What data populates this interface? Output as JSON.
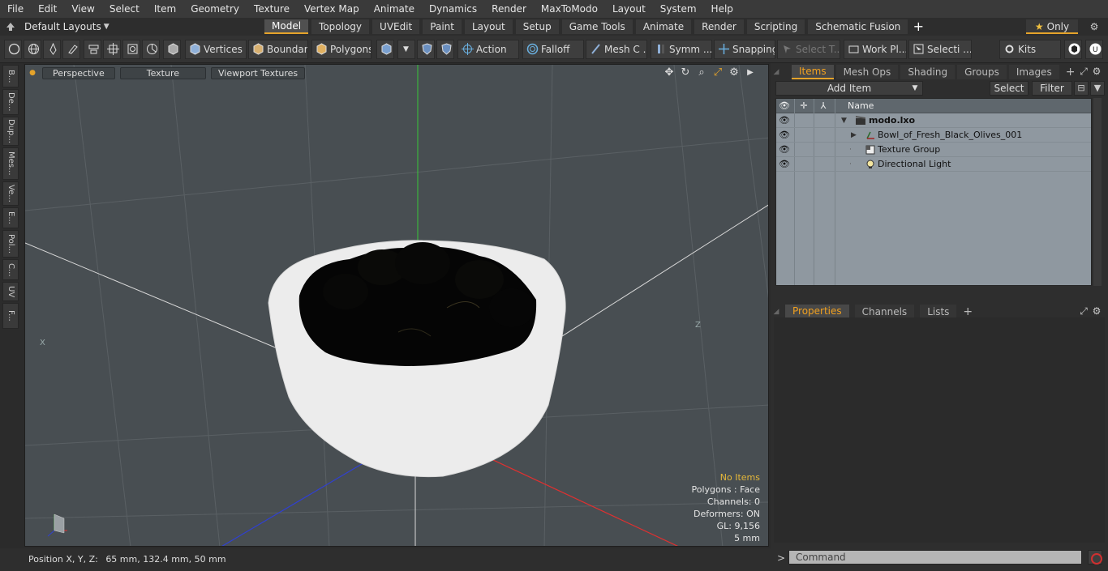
{
  "menubar": [
    "File",
    "Edit",
    "View",
    "Select",
    "Item",
    "Geometry",
    "Texture",
    "Vertex Map",
    "Animate",
    "Dynamics",
    "Render",
    "MaxToModo",
    "Layout",
    "System",
    "Help"
  ],
  "layouts": {
    "label": "Default Layouts",
    "tabs": [
      "Model",
      "Topology",
      "UVEdit",
      "Paint",
      "Layout",
      "Setup",
      "Game Tools",
      "Animate",
      "Render",
      "Scripting",
      "Schematic Fusion"
    ],
    "active_tab": "Model",
    "only_label": "Only"
  },
  "toolbar": {
    "vertices": "Vertices",
    "boundary": "Boundary",
    "polygons": "Polygons",
    "action": "Action",
    "falloff": "Falloff",
    "mesh": "Mesh C ...",
    "symmetry": "Symm ...",
    "snapping": "Snapping",
    "select_t": "Select T...",
    "work_plane": "Work Pl...",
    "selection": "Selecti ...",
    "kits": "Kits"
  },
  "left_tabs": [
    "B...",
    "De...",
    "Dup...",
    "Mes...",
    "Ve...",
    "E...",
    "Pol...",
    "C...",
    "UV",
    "F..."
  ],
  "viewport": {
    "buttons": [
      "Perspective",
      "Texture",
      "Viewport Textures"
    ],
    "info": {
      "no_items": "No Items",
      "polygons": "Polygons : Face",
      "channels": "Channels: 0",
      "deformers": "Deformers: ON",
      "gl": "GL: 9,156",
      "scale": "5 mm"
    },
    "axis_x_label": "X",
    "axis_z_label": "Z"
  },
  "status": {
    "position_label": "Position X, Y, Z:",
    "position_value": "65 mm, 132.4 mm, 50 mm"
  },
  "items_panel": {
    "tabs": [
      "Items",
      "Mesh Ops",
      "Shading",
      "Groups",
      "Images"
    ],
    "active_tab": "Items",
    "add_item": "Add Item",
    "select": "Select",
    "filter": "Filter",
    "column_name": "Name",
    "rows": [
      {
        "label": "modo.lxo",
        "bold": true
      },
      {
        "label": "Bowl_of_Fresh_Black_Olives_001",
        "bold": false
      },
      {
        "label": "Texture Group",
        "bold": false
      },
      {
        "label": "Directional Light",
        "bold": false
      }
    ]
  },
  "properties_panel": {
    "tabs": [
      "Properties",
      "Channels",
      "Lists"
    ],
    "active_tab": "Properties"
  },
  "command": {
    "placeholder": "Command",
    "prompt": ">"
  },
  "colors": {
    "accent": "#e5a32a",
    "viewport_bg": "#484e52",
    "tree_bg": "#8f98a0"
  }
}
